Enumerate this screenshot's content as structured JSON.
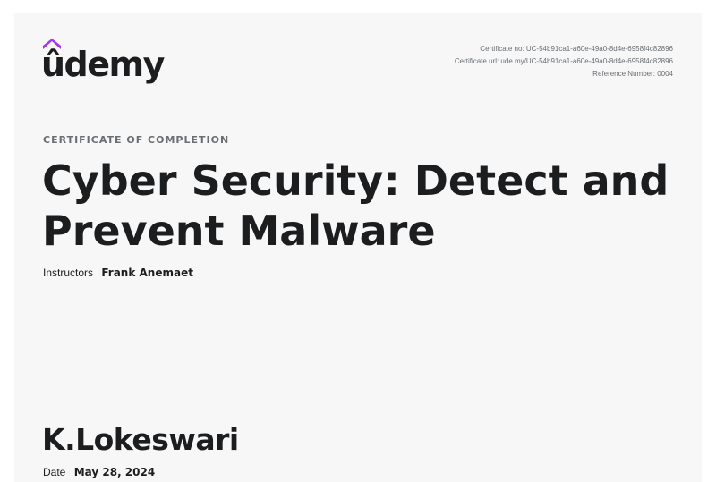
{
  "brand": {
    "name": "ûdemy",
    "accent_color": "#a435f0"
  },
  "certificate": {
    "number": "Certificate no: UC-54b91ca1-a60e-49a0-8d4e-6958f4c82896",
    "url": "Certificate url: ude.my/UC-54b91ca1-a60e-49a0-8d4e-6958f4c82896",
    "reference": "Reference Number: 0004",
    "eyebrow": "CERTIFICATE OF COMPLETION",
    "course_title": "Cyber Security: Detect and Prevent Malware",
    "instructors_label": "Instructors",
    "instructors": "Frank Anemaet",
    "student_name": "K.Lokeswari",
    "date_label": "Date",
    "date_value": "May 28, 2024"
  }
}
